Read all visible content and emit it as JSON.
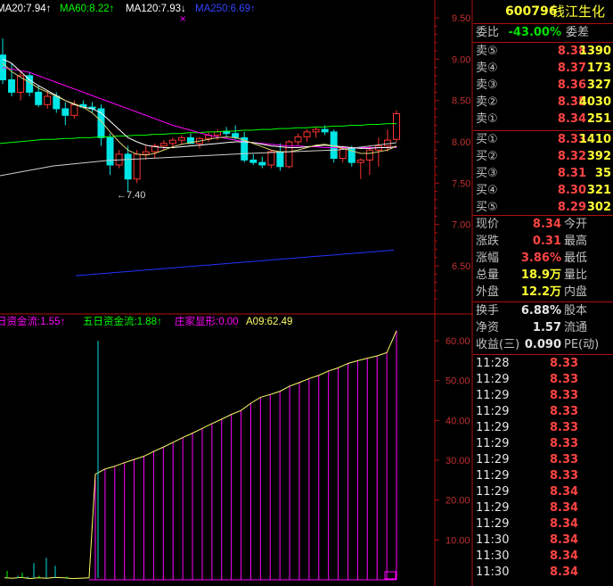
{
  "indicators": {
    "ma20": "MA20:7.94",
    "ma60": "MA60:8.22",
    "ma120": "MA120:7.93",
    "ma250": "MA250:6.69",
    "fund_flow_1d": "日资金流:1.55",
    "fund_flow_5d": "五日资金流:1.88",
    "dealer": "庄家显形:0.00",
    "a09": "A09:62.49"
  },
  "price_axis": [
    "9.50",
    "9.00",
    "8.50",
    "8.00",
    "7.50",
    "7.00",
    "6.50"
  ],
  "flow_axis": [
    "60.00",
    "50.00",
    "40.00",
    "30.00",
    "20.00",
    "10.00"
  ],
  "low_marker": "←7.40",
  "colors": {
    "up": "#ff3333",
    "down": "#00e5e5",
    "ma20": "#ffffff",
    "ma60": "#00ff00",
    "ma120": "#ff00ff",
    "ma250": "#2233ff",
    "grid": "#b01010",
    "flow": "#ff00ff",
    "a09": "#ffff66"
  },
  "quote": {
    "code": "600796",
    "name": "钱江生化",
    "weibi_label": "委比",
    "weibi_value": "-43.00%",
    "weicha_label": "委差",
    "sell": [
      {
        "label": "卖⑤",
        "price": "8.38",
        "vol": "1390"
      },
      {
        "label": "卖④",
        "price": "8.37",
        "vol": "173"
      },
      {
        "label": "卖③",
        "price": "8.36",
        "vol": "327"
      },
      {
        "label": "卖②",
        "price": "8.35",
        "vol": "4030"
      },
      {
        "label": "卖①",
        "price": "8.34",
        "vol": "251"
      }
    ],
    "buy": [
      {
        "label": "买①",
        "price": "8.33",
        "vol": "1410"
      },
      {
        "label": "买②",
        "price": "8.32",
        "vol": "392"
      },
      {
        "label": "买③",
        "price": "8.31",
        "vol": "35"
      },
      {
        "label": "买④",
        "price": "8.30",
        "vol": "321"
      },
      {
        "label": "买⑤",
        "price": "8.29",
        "vol": "302"
      }
    ],
    "stats": [
      {
        "l": "现价",
        "v": "8.34",
        "r": "今开"
      },
      {
        "l": "涨跌",
        "v": "0.31",
        "r": "最高"
      },
      {
        "l": "涨幅",
        "v": "3.86%",
        "r": "最低"
      },
      {
        "l": "总量",
        "v": "18.9万",
        "r": "量比"
      },
      {
        "l": "外盘",
        "v": "12.2万",
        "r": "内盘"
      }
    ],
    "stats2": [
      {
        "l": "换手",
        "v": "6.88%",
        "r": "股本"
      },
      {
        "l": "净资",
        "v": "1.57",
        "r": "流通"
      },
      {
        "l": "收益(三)",
        "v": "0.090",
        "r": "PE(动)"
      }
    ],
    "ticks": [
      {
        "t": "11:28",
        "p": "8.33"
      },
      {
        "t": "11:29",
        "p": "8.33"
      },
      {
        "t": "11:29",
        "p": "8.33"
      },
      {
        "t": "11:29",
        "p": "8.33"
      },
      {
        "t": "11:29",
        "p": "8.33"
      },
      {
        "t": "11:29",
        "p": "8.33"
      },
      {
        "t": "11:29",
        "p": "8.33"
      },
      {
        "t": "11:29",
        "p": "8.33"
      },
      {
        "t": "11:29",
        "p": "8.34"
      },
      {
        "t": "11:29",
        "p": "8.34"
      },
      {
        "t": "11:29",
        "p": "8.34"
      },
      {
        "t": "11:30",
        "p": "8.34"
      },
      {
        "t": "11:30",
        "p": "8.34"
      },
      {
        "t": "11:30",
        "p": "8.34"
      }
    ]
  },
  "chart_data": {
    "type": "candlestick",
    "price_range": [
      6.2,
      9.6
    ],
    "candles": [
      [
        9.05,
        9.25,
        8.7,
        8.75
      ],
      [
        8.75,
        8.95,
        8.55,
        8.6
      ],
      [
        8.6,
        8.85,
        8.5,
        8.8
      ],
      [
        8.8,
        8.85,
        8.55,
        8.6
      ],
      [
        8.6,
        8.68,
        8.42,
        8.45
      ],
      [
        8.45,
        8.62,
        8.4,
        8.55
      ],
      [
        8.55,
        8.6,
        8.35,
        8.4
      ],
      [
        8.4,
        8.48,
        8.2,
        8.32
      ],
      [
        8.32,
        8.5,
        8.28,
        8.45
      ],
      [
        8.45,
        8.5,
        8.4,
        8.42
      ],
      [
        8.42,
        8.48,
        8.35,
        8.4
      ],
      [
        8.4,
        8.45,
        7.95,
        8.05
      ],
      [
        8.05,
        8.1,
        7.6,
        7.72
      ],
      [
        7.72,
        7.9,
        7.68,
        7.85
      ],
      [
        7.85,
        7.95,
        7.4,
        7.55
      ],
      [
        7.55,
        7.9,
        7.5,
        7.85
      ],
      [
        7.85,
        7.95,
        7.78,
        7.88
      ],
      [
        7.88,
        7.98,
        7.8,
        7.95
      ],
      [
        7.95,
        8.02,
        7.9,
        7.98
      ],
      [
        7.98,
        8.05,
        7.92,
        8.02
      ],
      [
        8.02,
        8.08,
        7.96,
        8.05
      ],
      [
        8.05,
        8.1,
        7.98,
        7.98
      ],
      [
        7.98,
        8.06,
        7.92,
        8.04
      ],
      [
        8.04,
        8.12,
        8.0,
        8.08
      ],
      [
        8.08,
        8.15,
        8.02,
        8.12
      ],
      [
        8.12,
        8.18,
        8.05,
        8.1
      ],
      [
        8.1,
        8.2,
        8.02,
        8.05
      ],
      [
        8.05,
        8.12,
        7.75,
        7.78
      ],
      [
        7.78,
        7.85,
        7.72,
        7.75
      ],
      [
        7.75,
        7.82,
        7.68,
        7.72
      ],
      [
        7.72,
        7.9,
        7.68,
        7.88
      ],
      [
        7.88,
        7.98,
        7.65,
        7.7
      ],
      [
        7.7,
        8.02,
        7.68,
        8.0
      ],
      [
        8.0,
        8.1,
        7.96,
        8.06
      ],
      [
        8.06,
        8.15,
        8.0,
        8.12
      ],
      [
        8.12,
        8.18,
        8.05,
        8.15
      ],
      [
        8.15,
        8.2,
        8.08,
        8.12
      ],
      [
        8.12,
        8.15,
        7.75,
        7.8
      ],
      [
        7.8,
        7.95,
        7.75,
        7.92
      ],
      [
        7.92,
        7.95,
        7.7,
        7.75
      ],
      [
        7.75,
        7.8,
        7.55,
        7.78
      ],
      [
        7.78,
        7.95,
        7.6,
        7.9
      ],
      [
        7.9,
        8.05,
        7.7,
        7.95
      ],
      [
        7.95,
        8.15,
        7.88,
        8.02
      ],
      [
        8.03,
        8.38,
        8.0,
        8.34
      ]
    ],
    "ma20": [
      9.0,
      8.95,
      8.85,
      8.75,
      8.68,
      8.62,
      8.56,
      8.5,
      8.45,
      8.42,
      8.4,
      8.35,
      8.25,
      8.15,
      8.05,
      8.0,
      7.96,
      7.94,
      7.93,
      7.93,
      7.94,
      7.95,
      7.96,
      7.97,
      7.98,
      7.99,
      8.0,
      8.0,
      7.99,
      7.97,
      7.95,
      7.94,
      7.93,
      7.93,
      7.94,
      7.95,
      7.96,
      7.95,
      7.94,
      7.93,
      7.92,
      7.92,
      7.93,
      7.93,
      7.94
    ],
    "ma60": [
      7.98,
      7.99,
      8.0,
      8.01,
      8.02,
      8.03,
      8.03,
      8.04,
      8.04,
      8.05,
      8.05,
      8.06,
      8.06,
      8.07,
      8.07,
      8.08,
      8.08,
      8.09,
      8.09,
      8.1,
      8.1,
      8.11,
      8.11,
      8.12,
      8.12,
      8.13,
      8.13,
      8.14,
      8.14,
      8.15,
      8.15,
      8.16,
      8.16,
      8.17,
      8.17,
      8.18,
      8.18,
      8.19,
      8.19,
      8.2,
      8.2,
      8.21,
      8.21,
      8.22,
      8.22
    ],
    "ma120": [
      8.9,
      8.88,
      8.86,
      8.84,
      8.8,
      8.76,
      8.72,
      8.68,
      8.64,
      8.6,
      8.56,
      8.52,
      8.48,
      8.44,
      8.4,
      8.36,
      8.32,
      8.28,
      8.24,
      8.2,
      8.17,
      8.14,
      8.11,
      8.08,
      8.06,
      8.04,
      8.02,
      8.0,
      7.99,
      7.98,
      7.97,
      7.96,
      7.95,
      7.95,
      7.94,
      7.94,
      7.93,
      7.93,
      7.93,
      7.93,
      7.93,
      7.93,
      7.93,
      7.93,
      7.93
    ],
    "ma250": [
      6.38,
      6.39,
      6.4,
      6.41,
      6.42,
      6.43,
      6.44,
      6.45,
      6.46,
      6.47,
      6.48,
      6.49,
      6.5,
      6.51,
      6.52,
      6.53,
      6.54,
      6.55,
      6.56,
      6.57,
      6.58,
      6.59,
      6.6,
      6.61,
      6.62,
      6.63,
      6.64,
      6.65,
      6.66,
      6.67,
      6.68,
      6.69
    ],
    "ma10": [
      8.95,
      8.85,
      8.78,
      8.72,
      8.65,
      8.6,
      8.55,
      8.5,
      8.46,
      8.42,
      8.35,
      8.25,
      8.12,
      8.0,
      7.9,
      7.85,
      7.84,
      7.86,
      7.9,
      7.94,
      7.97,
      7.99,
      8.01,
      8.03,
      8.05,
      8.06,
      8.05,
      8.02,
      7.98,
      7.94,
      7.9,
      7.88,
      7.88,
      7.9,
      7.93,
      7.96,
      7.97,
      7.95,
      7.92,
      7.89,
      7.86,
      7.86,
      7.88,
      7.9,
      7.95
    ],
    "flow_range": [
      0,
      65
    ],
    "flow_values": [
      0.5,
      0.4,
      0.6,
      0.3,
      0.5,
      0.4,
      0.6,
      0.5,
      0.3,
      0.4,
      0.5,
      26.5,
      27.8,
      28.5,
      29.4,
      30.2,
      31.0,
      32.2,
      33.3,
      34.5,
      35.7,
      36.8,
      38.0,
      39.2,
      40.3,
      41.5,
      42.5,
      44.3,
      45.8,
      46.5,
      47.3,
      48.6,
      49.5,
      50.5,
      51.3,
      52.4,
      53.2,
      54.3,
      55.0,
      55.6,
      56.2,
      57.0,
      62.5
    ],
    "small_bars": [
      2.2,
      0.5,
      1.0,
      1.8,
      0.8,
      4.2,
      1.0,
      5.5,
      3.5,
      0.8,
      60.0
    ]
  }
}
